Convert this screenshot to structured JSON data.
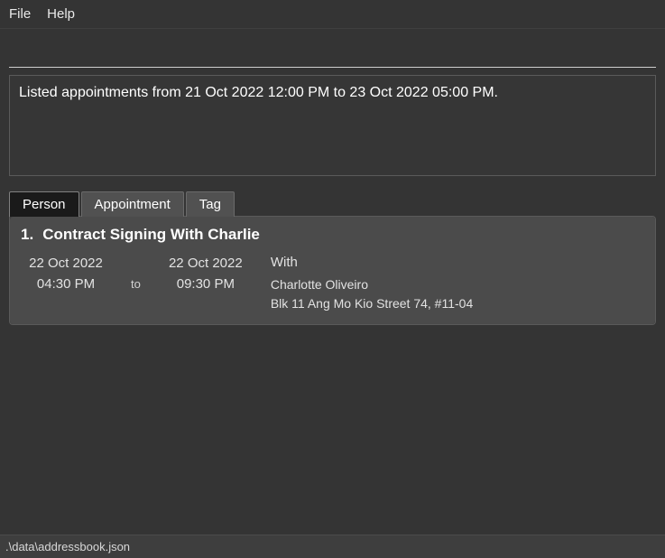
{
  "menu": {
    "file": "File",
    "help": "Help"
  },
  "message": "Listed appointments from 21 Oct 2022 12:00 PM to 23 Oct 2022 05:00 PM.",
  "tabs": {
    "person": "Person",
    "appointment": "Appointment",
    "tag": "Tag",
    "active": "person"
  },
  "appointments": [
    {
      "index": "1.",
      "title": "Contract Signing With Charlie",
      "start_date": "22 Oct 2022",
      "start_time": "04:30 PM",
      "to": "to",
      "end_date": "22 Oct 2022",
      "end_time": "09:30 PM",
      "with_label": "With",
      "with_name": "Charlotte Oliveiro",
      "address": "Blk 11 Ang Mo Kio Street 74, #11-04"
    }
  ],
  "statusbar": ".\\data\\addressbook.json"
}
